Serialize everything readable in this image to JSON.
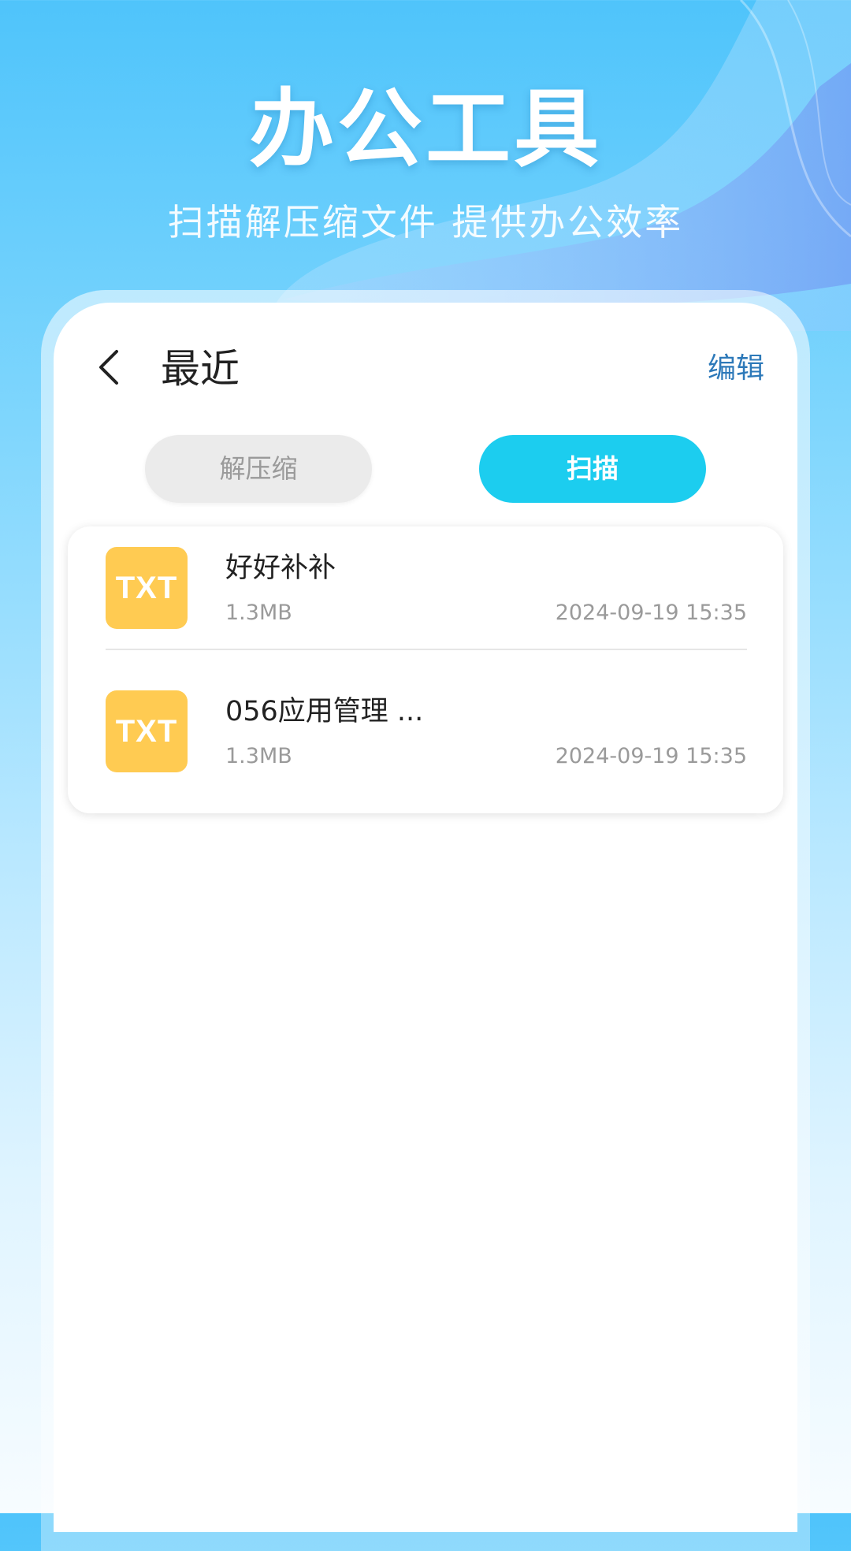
{
  "header": {
    "title": "办公工具",
    "subtitle": "扫描解压缩文件  提供办公效率"
  },
  "nav": {
    "title": "最近",
    "edit_label": "编辑"
  },
  "tabs": [
    {
      "label": "解压缩",
      "selected": false
    },
    {
      "label": "扫描",
      "selected": true
    }
  ],
  "files": [
    {
      "icon_label": "TXT",
      "name": "好好补补",
      "size": "1.3MB",
      "date": "2024-09-19 15:35"
    },
    {
      "icon_label": "TXT",
      "name": "056应用管理 ...",
      "size": "1.3MB",
      "date": "2024-09-19 15:35"
    }
  ],
  "colors": {
    "accent": "#1ccdef",
    "file_icon": "#ffcb52",
    "edit_link": "#2d79b9",
    "background_top": "#4fc4fb"
  },
  "icons": {
    "back": "chevron-left-icon",
    "file": "txt-file-icon"
  }
}
